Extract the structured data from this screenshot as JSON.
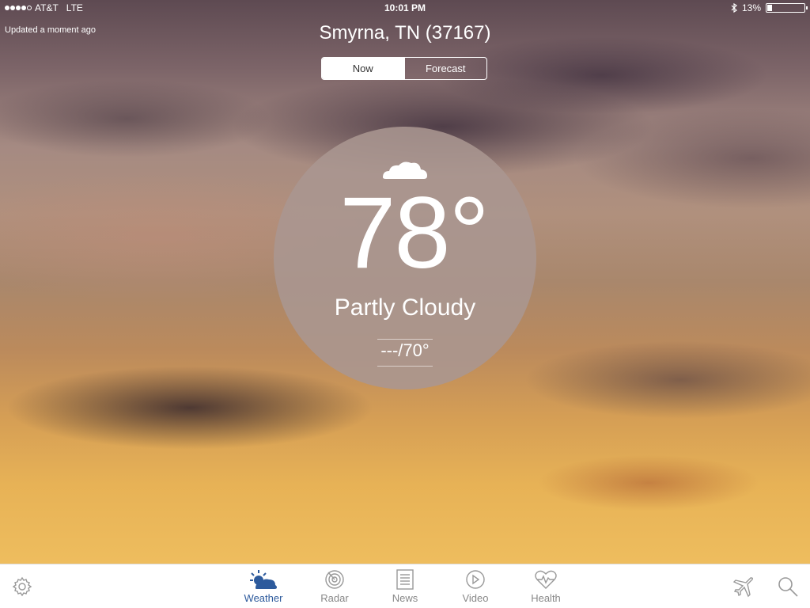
{
  "status_bar": {
    "carrier": "AT&T",
    "network": "LTE",
    "time": "10:01 PM",
    "battery_percent": "13%",
    "battery_level": 0.13,
    "signal_bars": 4,
    "signal_total": 5,
    "icons": {
      "bluetooth": "bluetooth-icon"
    }
  },
  "header": {
    "updated": "Updated a moment ago",
    "location": "Smyrna, TN (37167)"
  },
  "segmented": {
    "now_label": "Now",
    "forecast_label": "Forecast",
    "selected": "Now"
  },
  "current": {
    "icon": "partly-cloudy-night-icon",
    "temperature": "78°",
    "condition": "Partly Cloudy",
    "hi_lo": "---/70°"
  },
  "tabbar": {
    "settings_icon": "gear-icon",
    "tabs": [
      {
        "label": "Weather",
        "icon": "weather-icon",
        "active": true
      },
      {
        "label": "Radar",
        "icon": "radar-icon",
        "active": false
      },
      {
        "label": "News",
        "icon": "news-icon",
        "active": false
      },
      {
        "label": "Video",
        "icon": "video-icon",
        "active": false
      },
      {
        "label": "Health",
        "icon": "health-icon",
        "active": false
      }
    ],
    "travel_icon": "airplane-icon",
    "search_icon": "search-icon"
  },
  "colors": {
    "accent": "#2d5a9c",
    "inactive_tab": "#888888",
    "circle": "#aa9691"
  }
}
